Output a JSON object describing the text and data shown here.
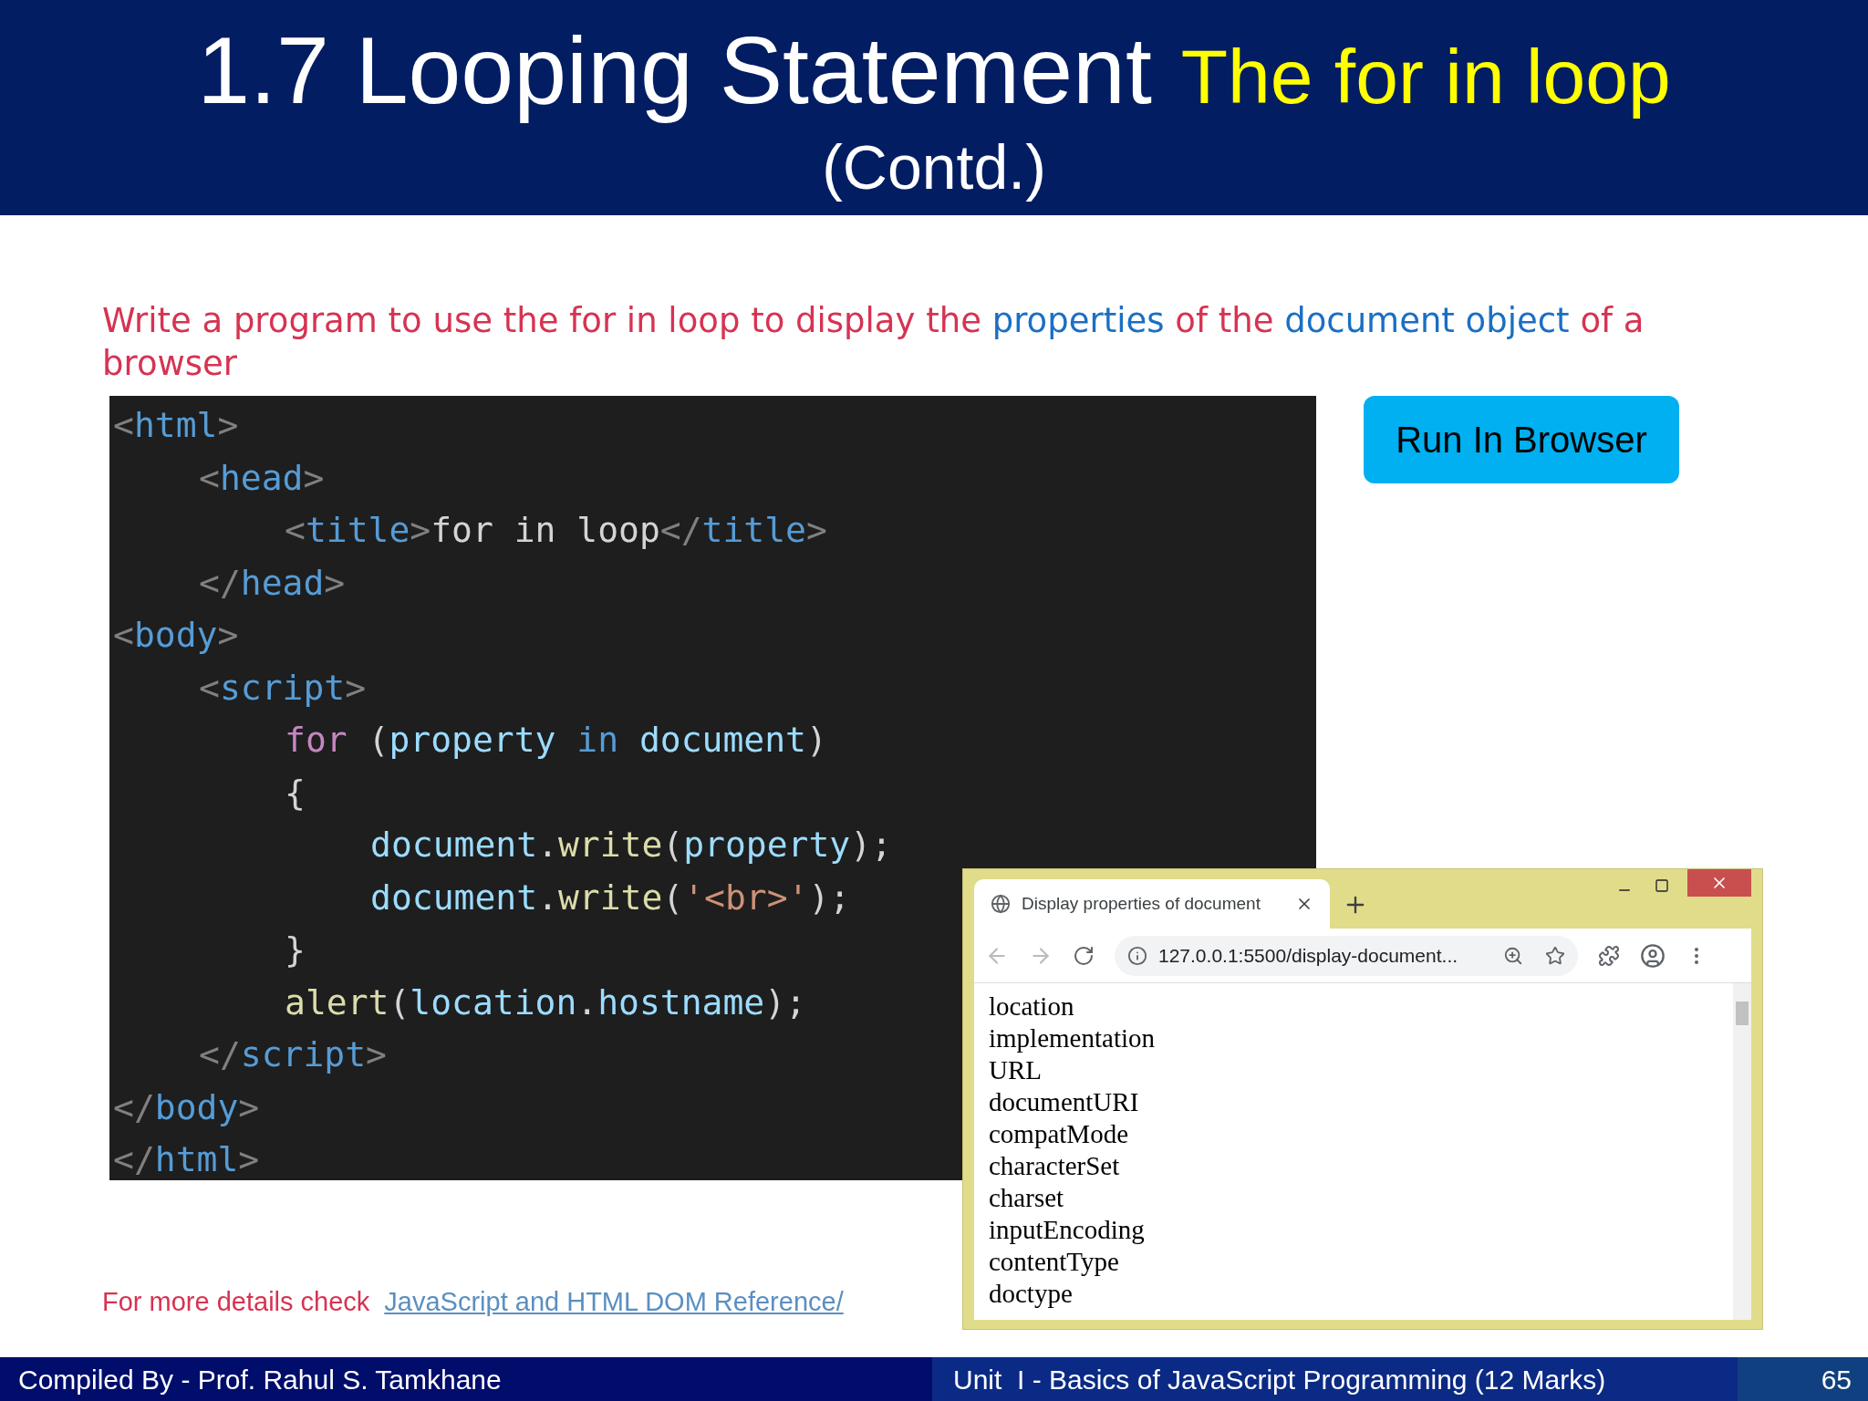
{
  "header": {
    "title": "1.7 Looping Statement",
    "subtitle": "The for in loop",
    "continuation": "(Contd.)"
  },
  "question": [
    {
      "text": "Write a program to use the for in loop to display the ",
      "kind": "plain"
    },
    {
      "text": "properties",
      "kind": "highlight"
    },
    {
      "text": " of the ",
      "kind": "plain"
    },
    {
      "text": "document object",
      "kind": "highlight"
    },
    {
      "text": " of a browser",
      "kind": "plain"
    }
  ],
  "code": [
    {
      "tokens": [
        {
          "t": "<",
          "kind": "punct"
        },
        {
          "t": "html",
          "kind": "tag"
        },
        {
          "t": ">",
          "kind": "punct"
        }
      ],
      "children": [
        {
          "tokens": [
            {
              "t": "<",
              "kind": "punct"
            },
            {
              "t": "head",
              "kind": "tag"
            },
            {
              "t": ">",
              "kind": "punct"
            }
          ],
          "children": [
            {
              "tokens": [
                {
                  "t": "<",
                  "kind": "punct"
                },
                {
                  "t": "title",
                  "kind": "tag"
                },
                {
                  "t": ">",
                  "kind": "punct"
                },
                {
                  "t": "for in loop",
                  "kind": "text"
                },
                {
                  "t": "</",
                  "kind": "punct"
                },
                {
                  "t": "title",
                  "kind": "tag"
                },
                {
                  "t": ">",
                  "kind": "punct"
                }
              ]
            }
          ]
        },
        {
          "tokens": [
            {
              "t": "</",
              "kind": "punct"
            },
            {
              "t": "head",
              "kind": "tag"
            },
            {
              "t": ">",
              "kind": "punct"
            }
          ]
        }
      ]
    },
    {
      "tokens": [
        {
          "t": "<",
          "kind": "punct"
        },
        {
          "t": "body",
          "kind": "tag"
        },
        {
          "t": ">",
          "kind": "punct"
        }
      ],
      "children": [
        {
          "tokens": [
            {
              "t": "<",
              "kind": "punct"
            },
            {
              "t": "script",
              "kind": "tag"
            },
            {
              "t": ">",
              "kind": "punct"
            }
          ],
          "children": [
            {
              "tokens": [
                {
                  "t": "for",
                  "kind": "keyword"
                },
                {
                  "t": " (",
                  "kind": "text"
                },
                {
                  "t": "property",
                  "kind": "variable"
                },
                {
                  "t": " in ",
                  "kind": "tag"
                },
                {
                  "t": "document",
                  "kind": "variable"
                },
                {
                  "t": ")",
                  "kind": "text"
                }
              ]
            },
            {
              "tokens": [
                {
                  "t": "{",
                  "kind": "text"
                }
              ],
              "children": [
                {
                  "tokens": [
                    {
                      "t": "document",
                      "kind": "variable"
                    },
                    {
                      "t": ".",
                      "kind": "text"
                    },
                    {
                      "t": "write",
                      "kind": "function"
                    },
                    {
                      "t": "(",
                      "kind": "text"
                    },
                    {
                      "t": "property",
                      "kind": "variable"
                    },
                    {
                      "t": ");",
                      "kind": "text"
                    }
                  ]
                },
                {
                  "tokens": [
                    {
                      "t": "document",
                      "kind": "variable"
                    },
                    {
                      "t": ".",
                      "kind": "text"
                    },
                    {
                      "t": "write",
                      "kind": "function"
                    },
                    {
                      "t": "(",
                      "kind": "text"
                    },
                    {
                      "t": "'<br>'",
                      "kind": "string"
                    },
                    {
                      "t": ");",
                      "kind": "text"
                    }
                  ]
                }
              ]
            },
            {
              "tokens": [
                {
                  "t": "}",
                  "kind": "text"
                }
              ]
            },
            {
              "tokens": [
                {
                  "t": "alert",
                  "kind": "function"
                },
                {
                  "t": "(",
                  "kind": "text"
                },
                {
                  "t": "location",
                  "kind": "variable"
                },
                {
                  "t": ".",
                  "kind": "text"
                },
                {
                  "t": "hostname",
                  "kind": "variable"
                },
                {
                  "t": ");",
                  "kind": "text"
                }
              ]
            }
          ]
        },
        {
          "tokens": [
            {
              "t": "</",
              "kind": "punct"
            },
            {
              "t": "script",
              "kind": "tag"
            },
            {
              "t": ">",
              "kind": "punct"
            }
          ]
        }
      ]
    },
    {
      "tokens": [
        {
          "t": "</",
          "kind": "punct"
        },
        {
          "t": "body",
          "kind": "tag"
        },
        {
          "t": ">",
          "kind": "punct"
        }
      ]
    },
    {
      "tokens": [
        {
          "t": "</",
          "kind": "punct"
        },
        {
          "t": "html",
          "kind": "tag"
        },
        {
          "t": ">",
          "kind": "punct"
        }
      ]
    }
  ],
  "run_button": "Run In Browser",
  "browser": {
    "tab_title": "Display properties of document",
    "url": "127.0.0.1:5500/display-document...",
    "content": [
      "location",
      "implementation",
      "URL",
      "documentURI",
      "compatMode",
      "characterSet",
      "charset",
      "inputEncoding",
      "contentType",
      "doctype"
    ]
  },
  "reference": {
    "text": "For more details check",
    "link": "JavaScript and HTML DOM Reference/"
  },
  "footer": {
    "author": "Compiled By - Prof. Rahul S. Tamkhane",
    "unit": "Unit  I - Basics of JavaScript Programming (12 Marks)",
    "page": "65"
  }
}
